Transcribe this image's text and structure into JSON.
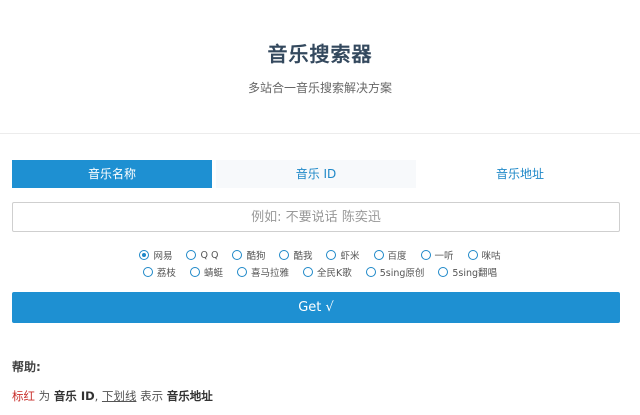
{
  "header": {
    "title": "音乐搜索器",
    "subtitle": "多站合一音乐搜索解决方案"
  },
  "tabs": [
    {
      "label": "音乐名称",
      "active": true
    },
    {
      "label": "音乐 ID",
      "active": false
    },
    {
      "label": "音乐地址",
      "active": false
    }
  ],
  "search": {
    "value": "",
    "placeholder": "例如: 不要说话 陈奕迅"
  },
  "sources": {
    "row1": [
      "网易",
      "Q Q",
      "酷狗",
      "酷我",
      "虾米",
      "百度",
      "一听",
      "咪咕"
    ],
    "row2": [
      "荔枝",
      "蜻蜓",
      "喜马拉雅",
      "全民K歌",
      "5sing原创",
      "5sing翻唱"
    ],
    "selected": "网易"
  },
  "get_button": {
    "label": "Get √"
  },
  "help": {
    "title": "帮助:",
    "red_text": "标红",
    "is1": "为",
    "music_id": "音乐 ID",
    "comma": ",",
    "underline_text": "下划线",
    "is2": "表示",
    "music_url": "音乐地址"
  },
  "colors": {
    "accent": "#1e90d2",
    "title": "#34495e",
    "help_red": "#c9302c"
  }
}
